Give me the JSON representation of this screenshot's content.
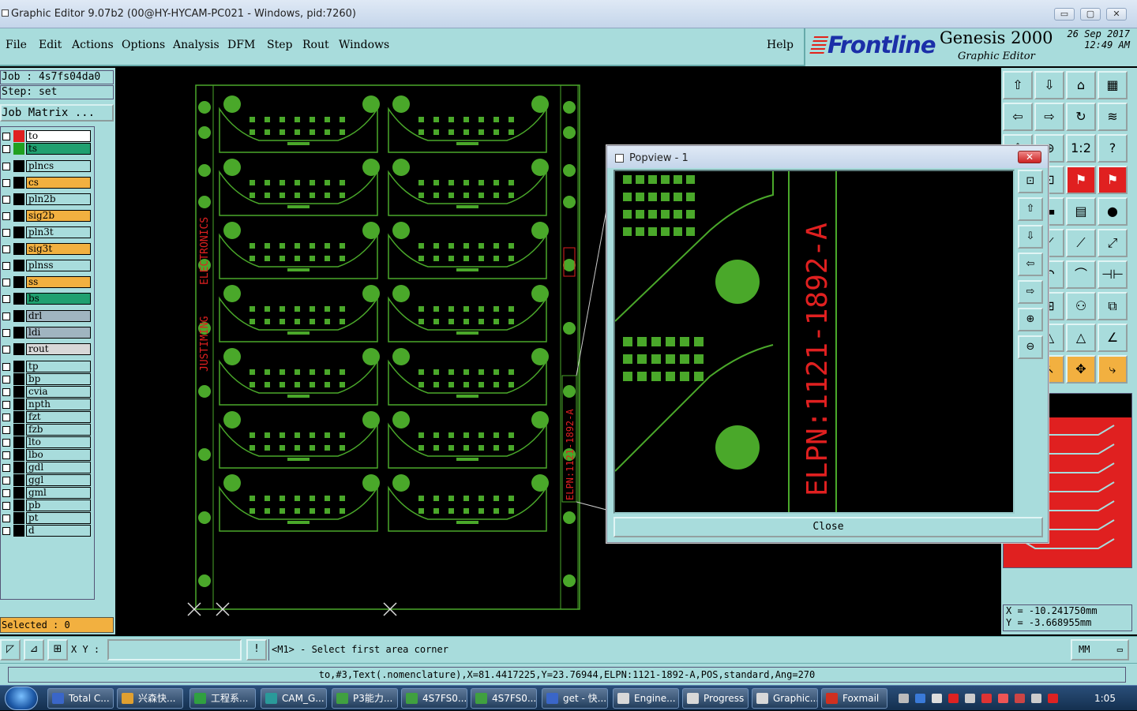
{
  "window": {
    "title": "Graphic Editor 9.07b2 (00@HY-HYCAM-PC021 - Windows, pid:7260)",
    "min_label": "▭",
    "max_label": "▢",
    "close_label": "✕"
  },
  "menu": {
    "items": [
      "File",
      "Edit",
      "Actions",
      "Options",
      "Analysis",
      "DFM",
      "Step",
      "Rout",
      "Windows"
    ],
    "help": "Help"
  },
  "brand": {
    "logo": "Frontline",
    "product": "Genesis 2000",
    "subtitle": "Graphic Editor",
    "date": "26 Sep 2017",
    "time": "12:49 AM"
  },
  "job": {
    "job_label": "Job : 4s7fs04da0",
    "step_label": "Step: set",
    "matrix_button": "Job Matrix ..."
  },
  "layers": [
    {
      "name": "to",
      "color": "#ffffff",
      "swatch": "#e02020",
      "active": true
    },
    {
      "name": "ts",
      "color": "#20a070",
      "swatch": "#20a020"
    },
    {
      "name": "plncs",
      "color": "#a8dcdc",
      "swatch": "#000000"
    },
    {
      "name": "cs",
      "color": "#f2b040",
      "swatch": "#000000"
    },
    {
      "name": "pln2b",
      "color": "#a8dcdc",
      "swatch": "#000000"
    },
    {
      "name": "sig2b",
      "color": "#f2b040",
      "swatch": "#000000"
    },
    {
      "name": "pln3t",
      "color": "#a8dcdc",
      "swatch": "#000000"
    },
    {
      "name": "sig3t",
      "color": "#f2b040",
      "swatch": "#000000"
    },
    {
      "name": "plnss",
      "color": "#a8dcdc",
      "swatch": "#000000"
    },
    {
      "name": "ss",
      "color": "#f2b040",
      "swatch": "#000000"
    },
    {
      "name": "bs",
      "color": "#20a070",
      "swatch": "#000000"
    },
    {
      "name": "drl",
      "color": "#a0b4c0",
      "swatch": "#000000"
    },
    {
      "name": "ldi",
      "color": "#a0b4c0",
      "swatch": "#000000"
    },
    {
      "name": "rout",
      "color": "#d8d8d8",
      "swatch": "#000000"
    },
    {
      "name": "tp",
      "color": "#a8dcdc",
      "swatch": "#000000"
    },
    {
      "name": "bp",
      "color": "#a8dcdc",
      "swatch": "#000000"
    },
    {
      "name": "cvia",
      "color": "#a8dcdc",
      "swatch": "#000000"
    },
    {
      "name": "npth",
      "color": "#a8dcdc",
      "swatch": "#000000"
    },
    {
      "name": "fzt",
      "color": "#a8dcdc",
      "swatch": "#000000"
    },
    {
      "name": "fzb",
      "color": "#a8dcdc",
      "swatch": "#000000"
    },
    {
      "name": "lto",
      "color": "#a8dcdc",
      "swatch": "#000000"
    },
    {
      "name": "lbo",
      "color": "#a8dcdc",
      "swatch": "#000000"
    },
    {
      "name": "gdl",
      "color": "#a8dcdc",
      "swatch": "#000000"
    },
    {
      "name": "ggl",
      "color": "#a8dcdc",
      "swatch": "#000000"
    },
    {
      "name": "gml",
      "color": "#a8dcdc",
      "swatch": "#000000"
    },
    {
      "name": "pb",
      "color": "#a8dcdc",
      "swatch": "#000000"
    },
    {
      "name": "pt",
      "color": "#a8dcdc",
      "swatch": "#000000"
    },
    {
      "name": "d",
      "color": "#a8dcdc",
      "swatch": "#000000"
    }
  ],
  "selected": "Selected : 0",
  "canvas": {
    "vertical_text_1": "ELECTRONICS",
    "vertical_text_2": "JUSTIMING",
    "part_number": "ELPN:1121-1892-A",
    "pcb_color": "#4aa82a",
    "text_color": "#e02020"
  },
  "popview": {
    "title": "Popview - 1",
    "part_number": "ELPN:1121-1892-A",
    "close_button": "Close",
    "tool_icons": [
      "zoom-fit-icon",
      "pan-up-icon",
      "pan-down-icon",
      "pan-left-icon",
      "pan-right-icon",
      "zoom-in-icon",
      "zoom-out-icon"
    ]
  },
  "toolbox_icons": [
    "pan-up-icon",
    "pan-down-icon",
    "home-icon",
    "split-view-icon",
    "pan-left-icon",
    "pan-right-icon",
    "redo-icon",
    "snap-icon",
    "zoom-area-icon",
    "zoom-out-icon",
    "scale-1-2-icon",
    "help-icon",
    "zoom-all-icon",
    "fit-icon",
    "measure-red-icon",
    "measure-blue-icon",
    "snap-icon",
    "grid-icon",
    "ruler-icon",
    "pad-icon",
    "cut-icon",
    "line-icon",
    "line-endpoint-icon",
    "line-arrow-icon",
    "arc-icon",
    "undo-icon",
    "arc-icon",
    "flip-icon",
    "minus-icon",
    "plus-icon",
    "measure-icon",
    "copy-icon",
    "angle-icon",
    "triangle-icon",
    "triangle-measure-icon",
    "angle-icon",
    "select-icon",
    "pointer-icon",
    "move-icon",
    "route-icon"
  ],
  "toolbox_labels": [
    "⇧",
    "⇩",
    "⌂",
    "▦",
    "⇦",
    "⇨",
    "↻",
    "≋",
    "⇳",
    "⊕",
    "1:2",
    "?",
    "⇱",
    "⊡",
    "⚑",
    "⚑",
    "⋈",
    "▬",
    "▤",
    "●",
    "✕",
    "⟋",
    "⟋",
    "⤢",
    "⌒",
    "↶",
    "⌒",
    "⊣⊢",
    "–",
    "⊞",
    "⚇",
    "⧉",
    "∠",
    "△",
    "△",
    "∠",
    "⬚",
    "↖",
    "✥",
    "⤷"
  ],
  "coords": {
    "x": "X = -10.241750mm",
    "y": "Y = -3.668955mm"
  },
  "command": {
    "xy_label": "X Y :",
    "xy_value": "",
    "prompt": "<M1> - Select first area corner",
    "units": "MM",
    "bang": "!"
  },
  "status": "to,#3,Text(.nomenclature),X=81.4417225,Y=23.76944,ELPN:1121-1892-A,POS,standard,Ang=270",
  "taskbar": {
    "tasks": [
      {
        "label": "Total C...",
        "icon": "#3a66c8"
      },
      {
        "label": "兴森快...",
        "icon": "#e0a030"
      },
      {
        "label": "工程系...",
        "icon": "#30a040"
      },
      {
        "label": "CAM_G...",
        "icon": "#2a9a9a"
      },
      {
        "label": "P3能力...",
        "icon": "#40a040"
      },
      {
        "label": "4S7FS0...",
        "icon": "#40a040"
      },
      {
        "label": "4S7FS0...",
        "icon": "#40a040"
      },
      {
        "label": "get - 快...",
        "icon": "#3a66c8"
      },
      {
        "label": "Engine...",
        "icon": "#d8d8d8"
      },
      {
        "label": "Progress",
        "icon": "#d8d8d8"
      },
      {
        "label": "Graphic...",
        "icon": "#d8d8d8"
      },
      {
        "label": "Foxmail",
        "icon": "#d03020"
      }
    ],
    "clock": "1:05"
  }
}
